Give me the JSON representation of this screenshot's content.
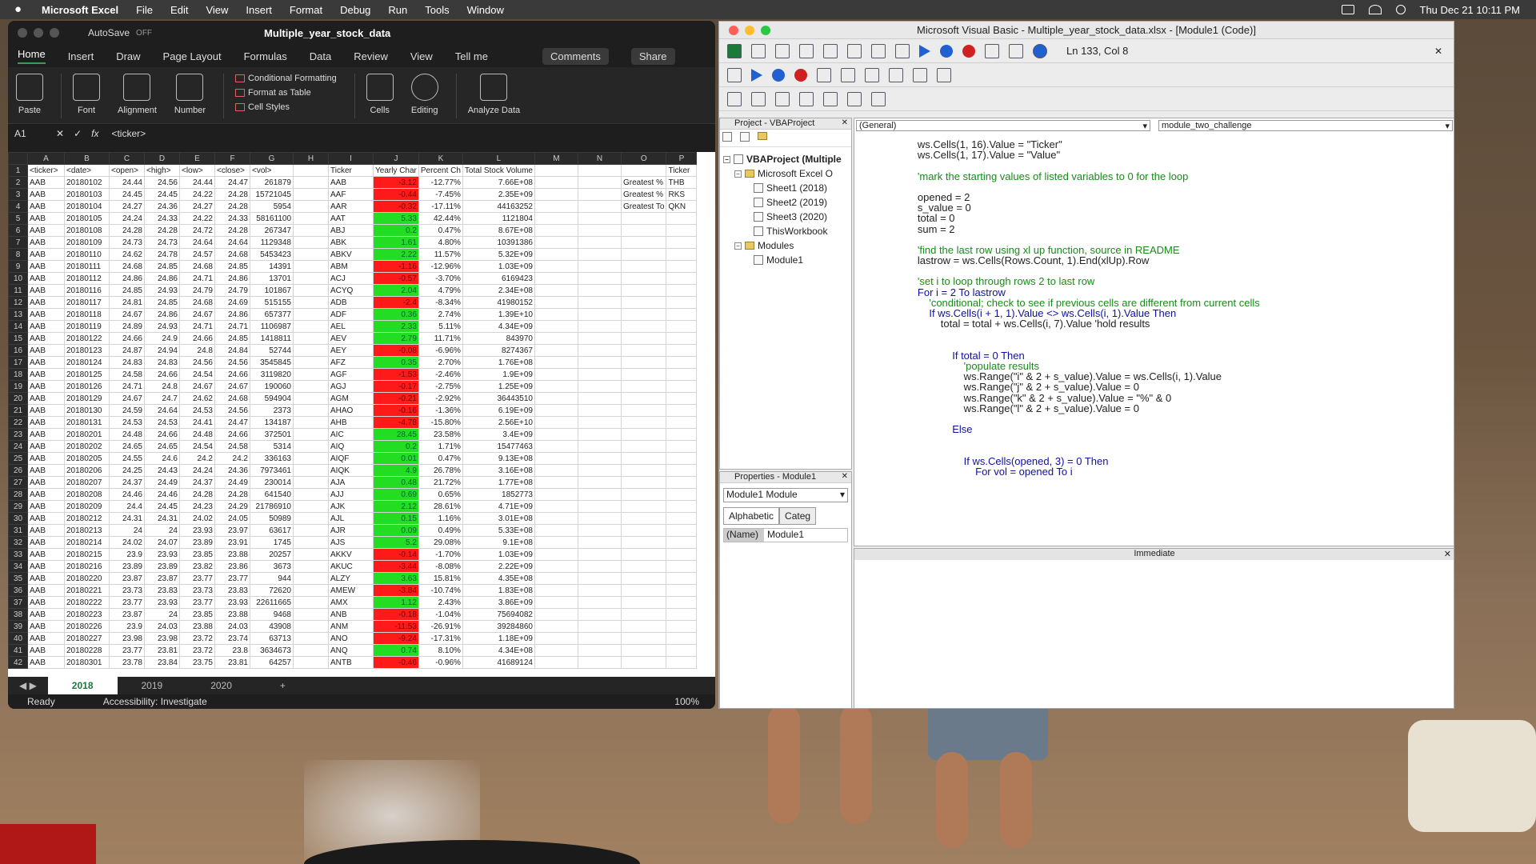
{
  "menubar": {
    "app": "Microsoft Excel",
    "items": [
      "File",
      "Edit",
      "View",
      "Insert",
      "Format",
      "Debug",
      "Run",
      "Tools",
      "Window"
    ],
    "clock": "Thu Dec 21  10:11 PM"
  },
  "excel": {
    "autosave": "AutoSave",
    "autosave_state": "OFF",
    "filename": "Multiple_year_stock_data",
    "tabs": [
      "Home",
      "Insert",
      "Draw",
      "Page Layout",
      "Formulas",
      "Data",
      "Review",
      "View"
    ],
    "tell_me": "Tell me",
    "comments": "Comments",
    "share": "Share",
    "ribbon": {
      "paste": "Paste",
      "font": "Font",
      "alignment": "Alignment",
      "number": "Number",
      "cond_format": "Conditional Formatting",
      "format_table": "Format as Table",
      "cell_styles": "Cell Styles",
      "cells": "Cells",
      "editing": "Editing",
      "analyze": "Analyze Data"
    },
    "namebox": "A1",
    "fx": "fx",
    "formula": "<ticker>",
    "columns": [
      "A",
      "B",
      "C",
      "D",
      "E",
      "F",
      "G",
      "H",
      "I",
      "J",
      "K",
      "L",
      "M",
      "N",
      "O",
      "P"
    ],
    "header_row": [
      "<ticker>",
      "<date>",
      "<open>",
      "<high>",
      "<low>",
      "<close>",
      "<vol>",
      "",
      "Ticker",
      "Yearly Char",
      "Percent Ch",
      "Total Stock Volume",
      "",
      "",
      "",
      "Ticker"
    ],
    "greatest": [
      [
        "Greatest %",
        "THB"
      ],
      [
        "Greatest %",
        "RKS"
      ],
      [
        "Greatest To",
        "QKN"
      ]
    ],
    "rows": [
      [
        "AAB",
        "20180102",
        "24.44",
        "24.56",
        "24.44",
        "24.47",
        "261879",
        "AAB",
        "-3.12",
        "-12.77%",
        "7.66E+08"
      ],
      [
        "AAB",
        "20180103",
        "24.45",
        "24.45",
        "24.22",
        "24.28",
        "15721045",
        "AAF",
        "-0.44",
        "-7.45%",
        "2.35E+09"
      ],
      [
        "AAB",
        "20180104",
        "24.27",
        "24.36",
        "24.27",
        "24.28",
        "5954",
        "AAR",
        "-0.32",
        "-17.11%",
        "44163252"
      ],
      [
        "AAB",
        "20180105",
        "24.24",
        "24.33",
        "24.22",
        "24.33",
        "58161100",
        "AAT",
        "5.33",
        "42.44%",
        "1121804"
      ],
      [
        "AAB",
        "20180108",
        "24.28",
        "24.28",
        "24.72",
        "24.28",
        "267347",
        "ABJ",
        "0.2",
        "0.47%",
        "8.67E+08"
      ],
      [
        "AAB",
        "20180109",
        "24.73",
        "24.73",
        "24.64",
        "24.64",
        "1129348",
        "ABK",
        "1.61",
        "4.80%",
        "10391386"
      ],
      [
        "AAB",
        "20180110",
        "24.62",
        "24.78",
        "24.57",
        "24.68",
        "5453423",
        "ABKV",
        "2.22",
        "11.57%",
        "5.32E+09"
      ],
      [
        "AAB",
        "20180111",
        "24.68",
        "24.85",
        "24.68",
        "24.85",
        "14391",
        "ABM",
        "-1.16",
        "-12.96%",
        "1.03E+09"
      ],
      [
        "AAB",
        "20180112",
        "24.86",
        "24.86",
        "24.71",
        "24.86",
        "13701",
        "ACJ",
        "-0.57",
        "-3.70%",
        "6169423"
      ],
      [
        "AAB",
        "20180116",
        "24.85",
        "24.93",
        "24.79",
        "24.79",
        "101867",
        "ACYQ",
        "2.04",
        "4.79%",
        "2.34E+08"
      ],
      [
        "AAB",
        "20180117",
        "24.81",
        "24.85",
        "24.68",
        "24.69",
        "515155",
        "ADB",
        "-2.4",
        "-8.34%",
        "41980152"
      ],
      [
        "AAB",
        "20180118",
        "24.67",
        "24.86",
        "24.67",
        "24.86",
        "657377",
        "ADF",
        "0.36",
        "2.74%",
        "1.39E+10"
      ],
      [
        "AAB",
        "20180119",
        "24.89",
        "24.93",
        "24.71",
        "24.71",
        "1106987",
        "AEL",
        "2.33",
        "5.11%",
        "4.34E+09"
      ],
      [
        "AAB",
        "20180122",
        "24.66",
        "24.9",
        "24.66",
        "24.85",
        "1418811",
        "AEV",
        "2.79",
        "11.71%",
        "843970"
      ],
      [
        "AAB",
        "20180123",
        "24.87",
        "24.94",
        "24.8",
        "24.84",
        "52744",
        "AEY",
        "-0.08",
        "-6.96%",
        "8274367"
      ],
      [
        "AAB",
        "20180124",
        "24.83",
        "24.83",
        "24.56",
        "24.56",
        "3545845",
        "AFZ",
        "0.35",
        "2.70%",
        "1.76E+08"
      ],
      [
        "AAB",
        "20180125",
        "24.58",
        "24.66",
        "24.54",
        "24.66",
        "3119820",
        "AGF",
        "-1.53",
        "-2.46%",
        "1.9E+09"
      ],
      [
        "AAB",
        "20180126",
        "24.71",
        "24.8",
        "24.67",
        "24.67",
        "190060",
        "AGJ",
        "-0.17",
        "-2.75%",
        "1.25E+09"
      ],
      [
        "AAB",
        "20180129",
        "24.67",
        "24.7",
        "24.62",
        "24.68",
        "594904",
        "AGM",
        "-0.21",
        "-2.92%",
        "36443510"
      ],
      [
        "AAB",
        "20180130",
        "24.59",
        "24.64",
        "24.53",
        "24.56",
        "2373",
        "AHAO",
        "-0.16",
        "-1.36%",
        "6.19E+09"
      ],
      [
        "AAB",
        "20180131",
        "24.53",
        "24.53",
        "24.41",
        "24.47",
        "134187",
        "AHB",
        "-4.78",
        "-15.80%",
        "2.56E+10"
      ],
      [
        "AAB",
        "20180201",
        "24.48",
        "24.66",
        "24.48",
        "24.66",
        "372501",
        "AIC",
        "28.45",
        "23.58%",
        "3.4E+09"
      ],
      [
        "AAB",
        "20180202",
        "24.65",
        "24.65",
        "24.54",
        "24.58",
        "5314",
        "AIQ",
        "0.2",
        "1.71%",
        "15477463"
      ],
      [
        "AAB",
        "20180205",
        "24.55",
        "24.6",
        "24.2",
        "24.2",
        "336163",
        "AIQF",
        "0.01",
        "0.47%",
        "9.13E+08"
      ],
      [
        "AAB",
        "20180206",
        "24.25",
        "24.43",
        "24.24",
        "24.36",
        "7973461",
        "AIQK",
        "4.9",
        "26.78%",
        "3.16E+08"
      ],
      [
        "AAB",
        "20180207",
        "24.37",
        "24.49",
        "24.37",
        "24.49",
        "230014",
        "AJA",
        "0.48",
        "21.72%",
        "1.77E+08"
      ],
      [
        "AAB",
        "20180208",
        "24.46",
        "24.46",
        "24.28",
        "24.28",
        "641540",
        "AJJ",
        "0.69",
        "0.65%",
        "1852773"
      ],
      [
        "AAB",
        "20180209",
        "24.4",
        "24.45",
        "24.23",
        "24.29",
        "21786910",
        "AJK",
        "2.12",
        "28.61%",
        "4.71E+09"
      ],
      [
        "AAB",
        "20180212",
        "24.31",
        "24.31",
        "24.02",
        "24.05",
        "50989",
        "AJL",
        "0.15",
        "1.16%",
        "3.01E+08"
      ],
      [
        "AAB",
        "20180213",
        "24",
        "24",
        "23.93",
        "23.97",
        "63617",
        "AJR",
        "0.09",
        "0.49%",
        "5.33E+08"
      ],
      [
        "AAB",
        "20180214",
        "24.02",
        "24.07",
        "23.89",
        "23.91",
        "1745",
        "AJS",
        "5.2",
        "29.08%",
        "9.1E+08"
      ],
      [
        "AAB",
        "20180215",
        "23.9",
        "23.93",
        "23.85",
        "23.88",
        "20257",
        "AKKV",
        "-0.14",
        "-1.70%",
        "1.03E+09"
      ],
      [
        "AAB",
        "20180216",
        "23.89",
        "23.89",
        "23.82",
        "23.86",
        "3673",
        "AKUC",
        "-3.44",
        "-8.08%",
        "2.22E+09"
      ],
      [
        "AAB",
        "20180220",
        "23.87",
        "23.87",
        "23.77",
        "23.77",
        "944",
        "ALZY",
        "3.63",
        "15.81%",
        "4.35E+08"
      ],
      [
        "AAB",
        "20180221",
        "23.73",
        "23.83",
        "23.73",
        "23.83",
        "72620",
        "AMEW",
        "-3.84",
        "-10.74%",
        "1.83E+08"
      ],
      [
        "AAB",
        "20180222",
        "23.77",
        "23.93",
        "23.77",
        "23.93",
        "22611665",
        "AMX",
        "1.12",
        "2.43%",
        "3.86E+09"
      ],
      [
        "AAB",
        "20180223",
        "23.87",
        "24",
        "23.85",
        "23.88",
        "9468",
        "ANB",
        "-0.18",
        "-1.04%",
        "75694082"
      ],
      [
        "AAB",
        "20180226",
        "23.9",
        "24.03",
        "23.88",
        "24.03",
        "43908",
        "ANM",
        "-11.53",
        "-26.91%",
        "39284860"
      ],
      [
        "AAB",
        "20180227",
        "23.98",
        "23.98",
        "23.72",
        "23.74",
        "63713",
        "ANO",
        "-9.24",
        "-17.31%",
        "1.18E+09"
      ],
      [
        "AAB",
        "20180228",
        "23.77",
        "23.81",
        "23.72",
        "23.8",
        "3634673",
        "ANQ",
        "0.74",
        "8.10%",
        "4.34E+08"
      ],
      [
        "AAB",
        "20180301",
        "23.78",
        "23.84",
        "23.75",
        "23.81",
        "64257",
        "ANTB",
        "-0.46",
        "-0.96%",
        "41689124"
      ]
    ],
    "sheet_tabs": [
      "2018",
      "2019",
      "2020"
    ],
    "status": {
      "ready": "Ready",
      "accessibility": "Accessibility: Investigate",
      "zoom": "100%"
    }
  },
  "vbe": {
    "title": "Microsoft Visual Basic - Multiple_year_stock_data.xlsx - [Module1 (Code)]",
    "position": "Ln 133, Col 8",
    "project_title": "Project - VBAProject",
    "tree": [
      "VBAProject (Multiple",
      "Microsoft Excel O",
      "Sheet1 (2018)",
      "Sheet2 (2019)",
      "Sheet3 (2020)",
      "ThisWorkbook",
      "Modules",
      "Module1"
    ],
    "props_title": "Properties - Module1",
    "props_select": "Module1 Module",
    "props_tab1": "Alphabetic",
    "props_tab2": "Categ",
    "props_name_key": "(Name)",
    "props_name_val": "Module1",
    "combo_left": "(General)",
    "combo_right": "module_two_challenge",
    "immediate": "Immediate",
    "code": [
      [
        "        ws.Cells(1, 16).Value = \"Ticker\"",
        ""
      ],
      [
        "        ws.Cells(1, 17).Value = \"Value\"",
        ""
      ],
      [
        "",
        ""
      ],
      [
        "        'mark the starting values of listed variables to 0 for the loop",
        "cm"
      ],
      [
        "",
        ""
      ],
      [
        "        opened = 2",
        ""
      ],
      [
        "        s_value = 0",
        ""
      ],
      [
        "        total = 0",
        ""
      ],
      [
        "        sum = 2",
        ""
      ],
      [
        "",
        ""
      ],
      [
        "        'find the last row using xl up function, source in README",
        "cm"
      ],
      [
        "        lastrow = ws.Cells(Rows.Count, 1).End(xlUp).Row",
        ""
      ],
      [
        "",
        ""
      ],
      [
        "        'set i to loop through rows 2 to last row",
        "cm"
      ],
      [
        "        For i = 2 To lastrow",
        "kw"
      ],
      [
        "            'conditional; check to see if previous cells are different from current cells",
        "cm"
      ],
      [
        "            If ws.Cells(i + 1, 1).Value <> ws.Cells(i, 1).Value Then",
        "kw"
      ],
      [
        "                total = total + ws.Cells(i, 7).Value 'hold results",
        ""
      ],
      [
        "",
        ""
      ],
      [
        "",
        ""
      ],
      [
        "                    If total = 0 Then",
        "kw"
      ],
      [
        "                        'populate results",
        "cm"
      ],
      [
        "                        ws.Range(\"i\" & 2 + s_value).Value = ws.Cells(i, 1).Value",
        ""
      ],
      [
        "                        ws.Range(\"j\" & 2 + s_value).Value = 0",
        ""
      ],
      [
        "                        ws.Range(\"k\" & 2 + s_value).Value = \"%\" & 0",
        ""
      ],
      [
        "                        ws.Range(\"l\" & 2 + s_value).Value = 0",
        ""
      ],
      [
        "",
        ""
      ],
      [
        "                    Else",
        "kw"
      ],
      [
        "",
        ""
      ],
      [
        "",
        ""
      ],
      [
        "                        If ws.Cells(opened, 3) = 0 Then",
        "kw"
      ],
      [
        "                            For vol = opened To i",
        "kw"
      ]
    ]
  }
}
